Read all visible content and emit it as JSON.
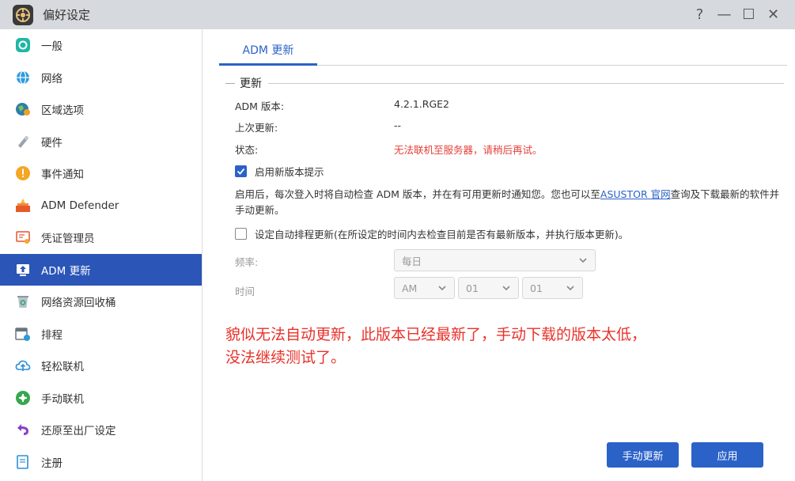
{
  "window": {
    "title": "偏好设定",
    "help_glyph": "?",
    "minimize_glyph": "—",
    "maximize_glyph": "☐",
    "close_glyph": "✕"
  },
  "sidebar": {
    "items": [
      {
        "label": "一般",
        "icon": "general-icon",
        "active": false
      },
      {
        "label": "网络",
        "icon": "globe-icon",
        "active": false
      },
      {
        "label": "区域选项",
        "icon": "region-icon",
        "active": false
      },
      {
        "label": "硬件",
        "icon": "hardware-icon",
        "active": false
      },
      {
        "label": "事件通知",
        "icon": "alert-icon",
        "active": false
      },
      {
        "label": "ADM Defender",
        "icon": "defender-icon",
        "active": false
      },
      {
        "label": "凭证管理员",
        "icon": "certificate-icon",
        "active": false
      },
      {
        "label": "ADM 更新",
        "icon": "update-icon",
        "active": true
      },
      {
        "label": "网络资源回收桶",
        "icon": "recycle-bin-icon",
        "active": false
      },
      {
        "label": "排程",
        "icon": "schedule-icon",
        "active": false
      },
      {
        "label": "轻松联机",
        "icon": "cloud-connect-icon",
        "active": false
      },
      {
        "label": "手动联机",
        "icon": "manual-connect-icon",
        "active": false
      },
      {
        "label": "还原至出厂设定",
        "icon": "restore-icon",
        "active": false
      },
      {
        "label": "注册",
        "icon": "register-icon",
        "active": false
      }
    ]
  },
  "main": {
    "tab_label": "ADM 更新",
    "section_title": "更新",
    "adm_version_label": "ADM 版本:",
    "adm_version_value": "4.2.1.RGE2",
    "last_update_label": "上次更新:",
    "last_update_value": "--",
    "status_label": "状态:",
    "status_value": "无法联机至服务器，请稍后再试。",
    "enable_prompt_label": "启用新版本提示",
    "enable_prompt_checked": true,
    "description_part1": "启用后，每次登入时将自动检查 ADM 版本，并在有可用更新时通知您。您也可以至",
    "description_link": "ASUSTOR 官网",
    "description_part2": "查询及下载最新的软件并手动更新。",
    "auto_schedule_label": "设定自动排程更新(在所设定的时间内去检查目前是否有最新版本，并执行版本更新)。",
    "auto_schedule_checked": false,
    "frequency_label": "频率:",
    "frequency_value": "每日",
    "time_label": "时间",
    "time_ampm": "AM",
    "time_hour": "01",
    "time_minute": "01",
    "annotation_line1": "貌似无法自动更新，此版本已经最新了，手动下载的版本太低，",
    "annotation_line2": "没法继续测试了。",
    "manual_update_button": "手动更新",
    "apply_button": "应用"
  },
  "colors": {
    "accent": "#2b62c8",
    "sidebar_active": "#2b55b7",
    "error": "#e5403a",
    "annotation": "#e8322b",
    "titlebar": "#d6d9dd"
  }
}
